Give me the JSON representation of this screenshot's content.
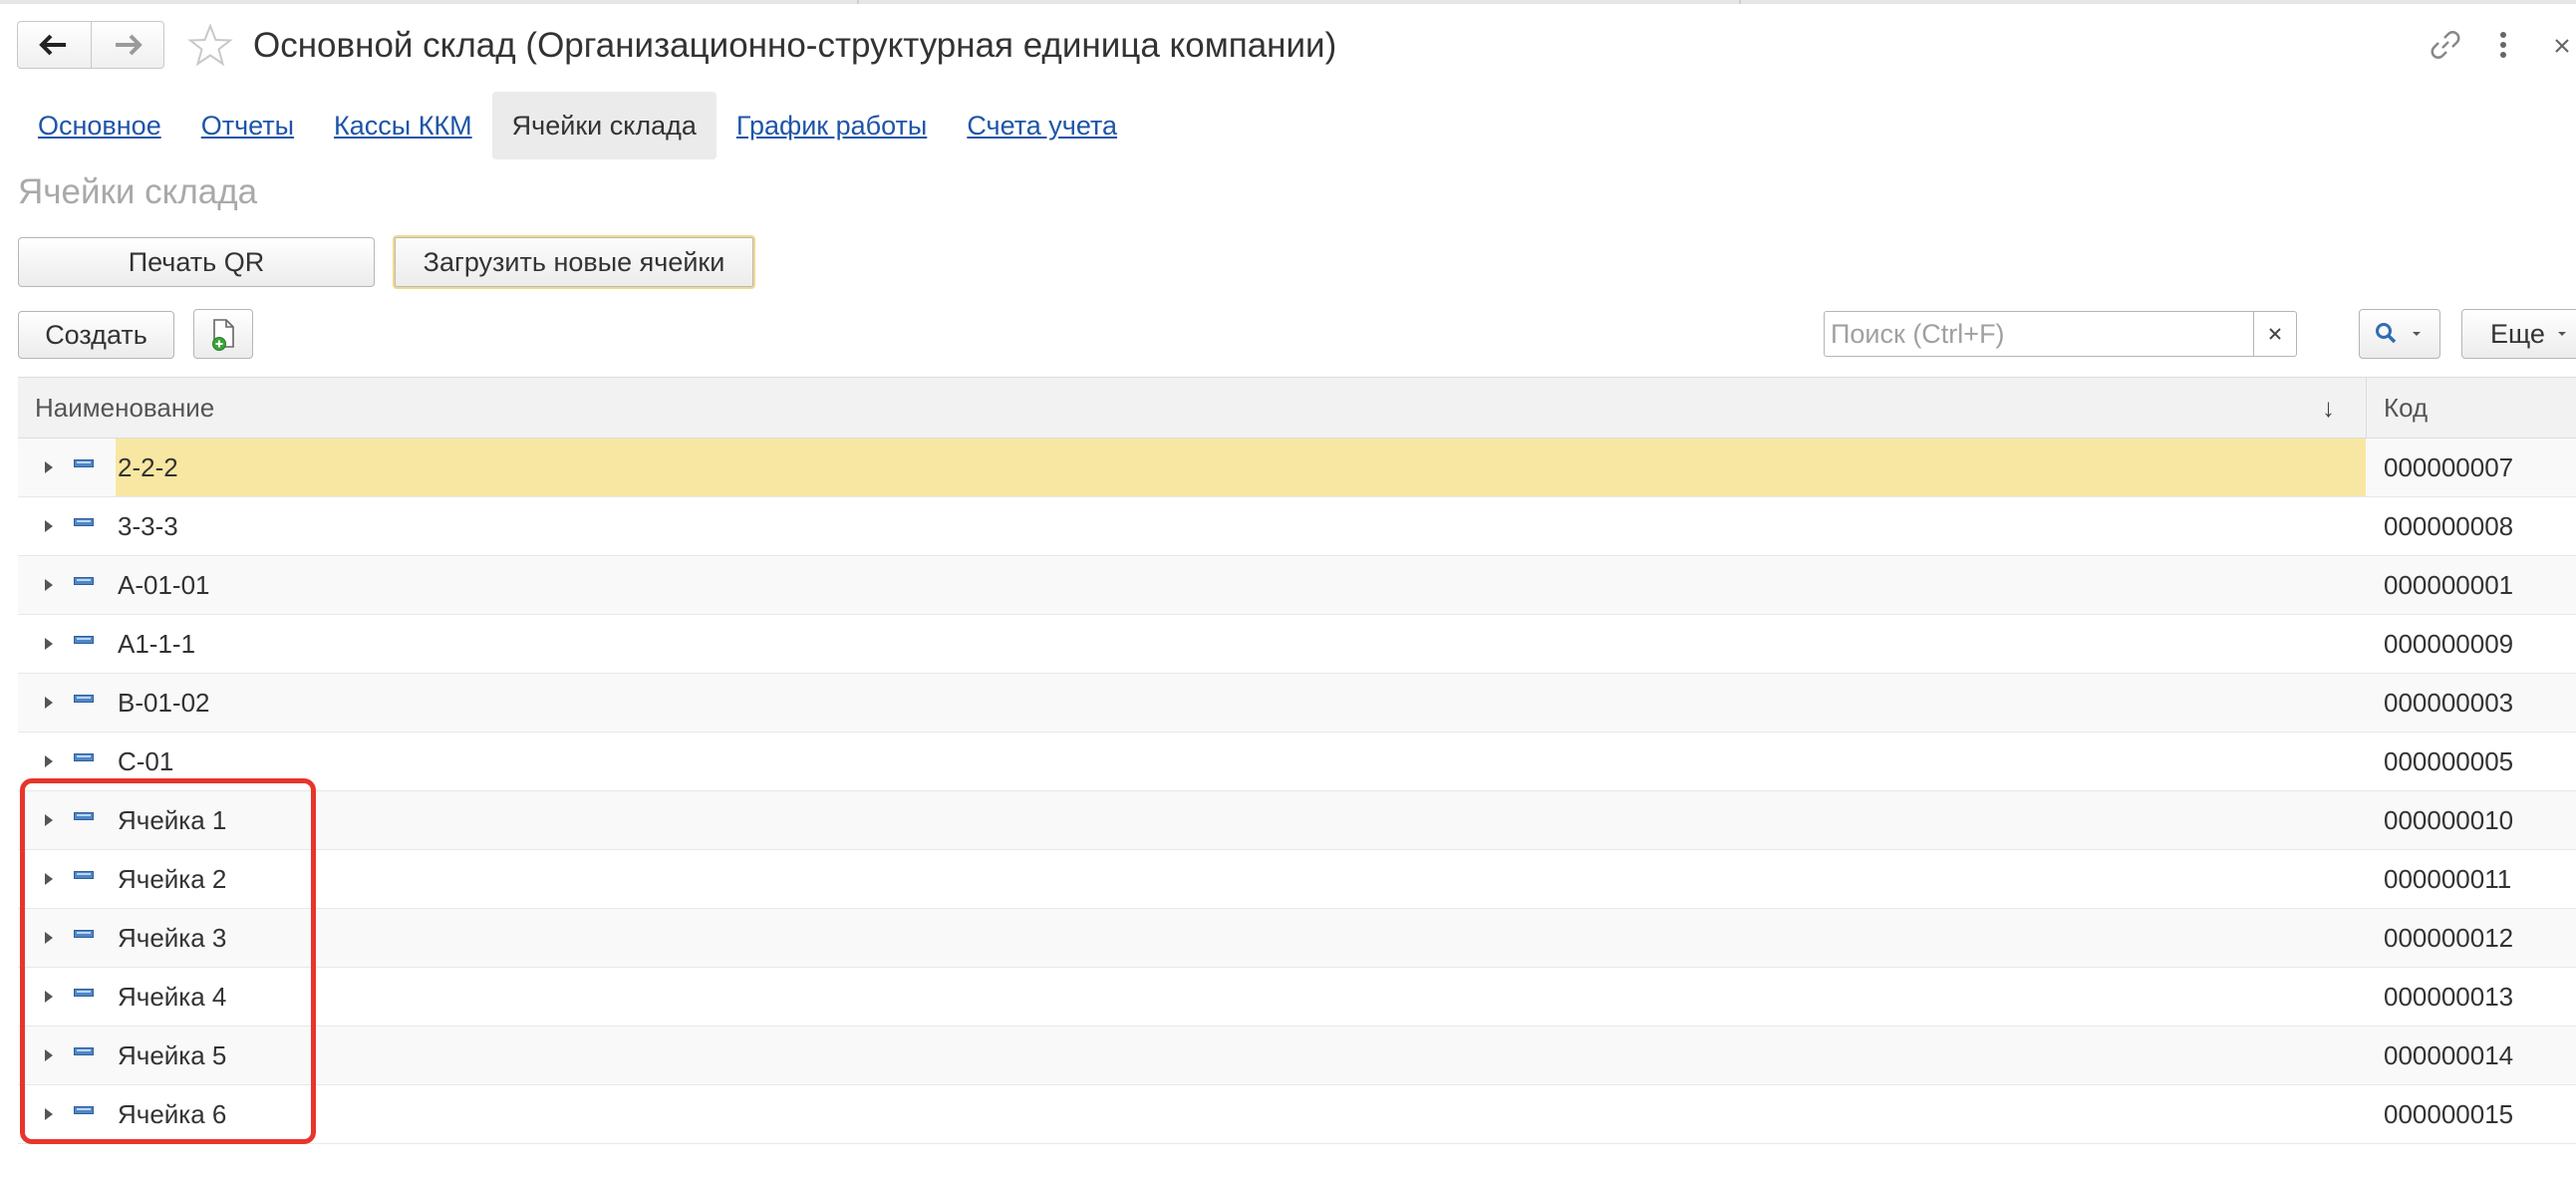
{
  "window": {
    "title": "Основной склад (Организационно-структурная единица компании)"
  },
  "tabs": [
    {
      "label": "Основное",
      "active": false
    },
    {
      "label": "Отчеты",
      "active": false
    },
    {
      "label": "Кассы ККМ",
      "active": false
    },
    {
      "label": "Ячейки склада",
      "active": true
    },
    {
      "label": "График работы",
      "active": false
    },
    {
      "label": "Счета учета",
      "active": false
    }
  ],
  "section": {
    "title": "Ячейки склада"
  },
  "actions": {
    "print_qr": "Печать QR",
    "load_cells": "Загрузить новые ячейки",
    "create": "Создать",
    "more": "Еще"
  },
  "search": {
    "placeholder": "Поиск (Ctrl+F)",
    "value": ""
  },
  "table": {
    "columns": {
      "name": "Наименование",
      "code": "Код"
    },
    "sort_indicator": "↓",
    "rows": [
      {
        "name": "2-2-2",
        "code": "000000007",
        "selected": true
      },
      {
        "name": "3-3-3",
        "code": "000000008"
      },
      {
        "name": "A-01-01",
        "code": "000000001"
      },
      {
        "name": "A1-1-1",
        "code": "000000009"
      },
      {
        "name": "B-01-02",
        "code": "000000003"
      },
      {
        "name": "C-01",
        "code": "000000005"
      },
      {
        "name": "Ячейка 1",
        "code": "000000010"
      },
      {
        "name": "Ячейка 2",
        "code": "000000011"
      },
      {
        "name": "Ячейка 3",
        "code": "000000012"
      },
      {
        "name": "Ячейка 4",
        "code": "000000013"
      },
      {
        "name": "Ячейка 5",
        "code": "000000014"
      },
      {
        "name": "Ячейка 6",
        "code": "000000015"
      }
    ]
  },
  "colors": {
    "link": "#1e55a8",
    "selected_row": "#f8e7a2",
    "highlight_frame": "#e8352b",
    "item_icon": "#4f86c6"
  },
  "icons": [
    "arrow-left-icon",
    "arrow-right-icon",
    "star-icon",
    "link-icon",
    "more-vertical-icon",
    "close-icon",
    "add-copy-icon",
    "search-icon",
    "chevron-down-icon",
    "expand-arrow-icon",
    "item-icon"
  ]
}
